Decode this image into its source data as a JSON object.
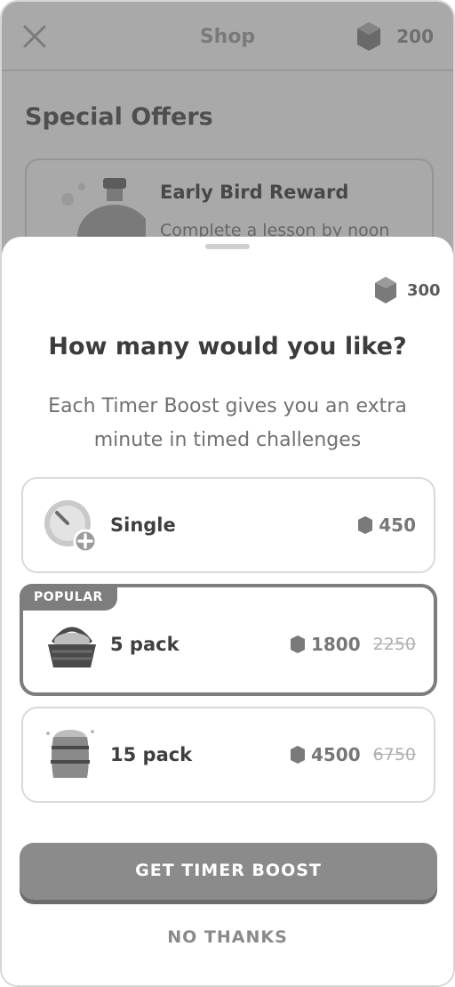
{
  "header": {
    "title": "Shop",
    "gem_count": "200"
  },
  "shop": {
    "section_title": "Special Offers",
    "offer": {
      "title": "Early Bird Reward",
      "subtitle": "Complete a lesson by noon"
    }
  },
  "sheet": {
    "gem_count": "300",
    "question": "How many would you like?",
    "description": "Each Timer Boost gives you an extra minute in timed challenges",
    "options": [
      {
        "label": "Single",
        "price": "450",
        "icon": "timer-plus-icon"
      },
      {
        "label": "5 pack",
        "price": "1800",
        "old_price": "2250",
        "badge": "POPULAR",
        "icon": "basket-icon",
        "selected": true
      },
      {
        "label": "15 pack",
        "price": "4500",
        "old_price": "6750",
        "icon": "barrel-icon"
      }
    ],
    "cta_label": "GET TIMER BOOST",
    "dismiss_label": "NO THANKS"
  },
  "colors": {
    "accent_selected": "#7d7d7d",
    "cta": "#8b8b8b"
  }
}
